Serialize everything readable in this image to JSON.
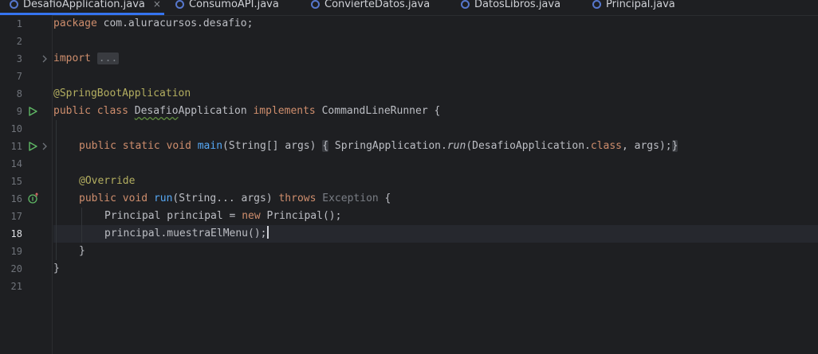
{
  "tabs": [
    {
      "label": "DesafioApplication.java",
      "active": true,
      "close": "×"
    },
    {
      "label": "ConsumoAPI.java",
      "active": false
    },
    {
      "label": "ConvierteDatos.java",
      "active": false
    },
    {
      "label": "DatosLibros.java",
      "active": false
    },
    {
      "label": "Principal.java",
      "active": false
    }
  ],
  "gutter": {
    "line_numbers": [
      "1",
      "2",
      "3",
      "7",
      "8",
      "9",
      "10",
      "11",
      "14",
      "15",
      "16",
      "17",
      "18",
      "19",
      "20",
      "21"
    ],
    "current_line": "18"
  },
  "code": {
    "l1": {
      "kw": "package",
      "pkg": " com.aluracursos.desafio;"
    },
    "l3": {
      "kw": "import",
      "folded": "..."
    },
    "l8": {
      "ann": "@SpringBootApplication"
    },
    "l9": {
      "kw1": "public",
      "kw2": "class",
      "name_a": "Desafio",
      "name_b": "Application",
      "kw3": "implements",
      "rest": " CommandLineRunner {"
    },
    "l11": {
      "kw1": "public",
      "kw2": "static",
      "kw3": "void",
      "fn": "main",
      "params": "(String[] args) ",
      "lbrace": "{",
      "call1": " SpringApplication.",
      "call_run": "run",
      "call2": "(DesafioApplication.",
      "kw_class": "class",
      "call3": ", args);",
      "rbrace": "}"
    },
    "l15": {
      "ann": "@Override"
    },
    "l16": {
      "kw1": "public",
      "kw2": "void",
      "fn": "run",
      "params": "(String... args) ",
      "kw3": "throws",
      "exc": " Exception",
      "rest": " {"
    },
    "l17": {
      "a": "Principal principal = ",
      "kw": "new",
      "b": " Principal();"
    },
    "l18": {
      "text": "principal.muestraElMenu();"
    },
    "l19": {
      "text": "}"
    },
    "l20": {
      "text": "}"
    }
  },
  "colors": {
    "keyword": "#cf8e6d",
    "annotation": "#b3ae60",
    "function": "#56a8f5",
    "accent": "#3574f0"
  }
}
